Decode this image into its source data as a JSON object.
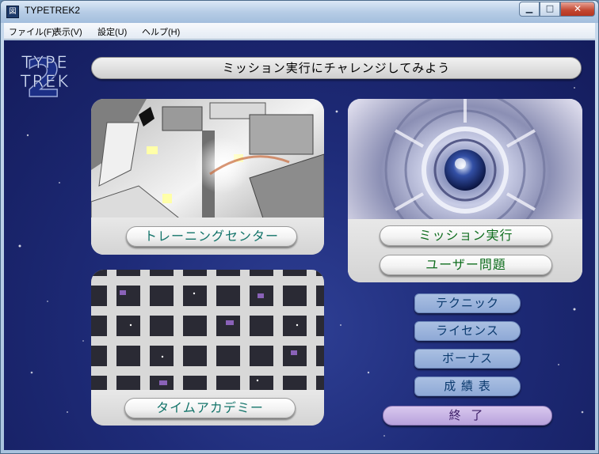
{
  "window": {
    "title": "TYPETREK2",
    "icon_glyph": "図",
    "min_glyph": "▁",
    "max_glyph": "□",
    "close_glyph": "✕"
  },
  "menu": {
    "items": [
      {
        "label": "ファイル(F)"
      },
      {
        "label": "表示(V)"
      },
      {
        "label": "設定(U)"
      },
      {
        "label": "ヘルプ(H)"
      }
    ]
  },
  "logo": {
    "line1": "TYPE",
    "line2": "TREK",
    "numeral": "2"
  },
  "banner": {
    "text": "ミッション実行にチャレンジしてみよう"
  },
  "panels": {
    "training": {
      "label": "トレーニングセンター"
    },
    "mission": {
      "label": "ミッション実行",
      "user_label": "ユーザー問題"
    },
    "time": {
      "label": "タイムアカデミー"
    }
  },
  "side_buttons": {
    "technique": "テクニック",
    "license": "ライセンス",
    "bonus": "ボーナス",
    "records": "成 績 表",
    "exit": "終 了"
  },
  "colors": {
    "background": "#1e2b78",
    "pill_text_teal": "#13746a",
    "pill_text_green": "#0f6d1e",
    "side_button": "#9bb4de",
    "exit_button": "#c8b6e6"
  }
}
